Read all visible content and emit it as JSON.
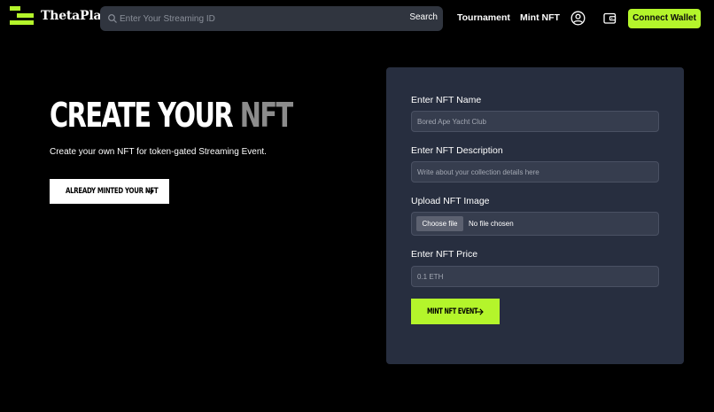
{
  "brand": {
    "name": "ThetaPlay",
    "accent_color": "#b4f52b"
  },
  "header": {
    "search": {
      "placeholder": "Enter Your Streaming ID",
      "button_label": "Search"
    },
    "nav": {
      "tournament": "Tournament",
      "mint_nft": "Mint NFT"
    },
    "icons": {
      "profile": "user-circle-icon",
      "wallet": "wallet-icon"
    },
    "connect_wallet_label": "Connect Wallet"
  },
  "hero": {
    "title_part1": "CREATE YOUR",
    "title_part2": "NFT",
    "subtitle": "Create your own NFT for token-gated Streaming Event.",
    "minted_button_label": "ALREADY MINTED YOUR NFT"
  },
  "form": {
    "name": {
      "label": "Enter NFT Name",
      "placeholder": "Bored Ape Yacht Club"
    },
    "description": {
      "label": "Enter NFT Description",
      "placeholder": "Write about your collection details here"
    },
    "image": {
      "label": "Upload NFT Image",
      "button_label": "Choose file",
      "status": "No file chosen"
    },
    "price": {
      "label": "Enter NFT Price",
      "placeholder": "0.1 ETH"
    },
    "submit_label": "MINT NFT EVENT"
  }
}
